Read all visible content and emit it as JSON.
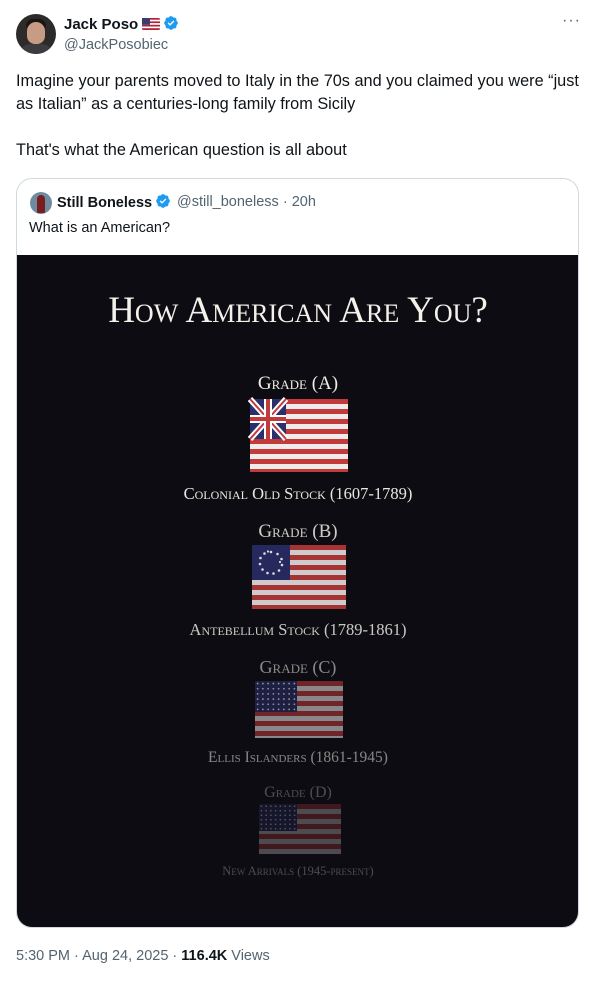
{
  "author": {
    "display_name": "Jack Poso",
    "handle": "@JackPosobiec"
  },
  "more_label": "···",
  "tweet": {
    "line1": "Imagine your parents moved to Italy in the 70s and you claimed you were “just as Italian” as a centuries-long family from Sicily",
    "line2": "That's what the American question is all about"
  },
  "quoted": {
    "display_name": "Still Boneless",
    "handle": "@still_boneless",
    "separator": "·",
    "time": "20h",
    "text": "What is an American?",
    "media": {
      "title": "How American Are You?",
      "grades": [
        {
          "label": "Grade (A)",
          "caption": "Colonial Old Stock (1607-1789)",
          "flag": "grand-union-flag",
          "opacity": 1.0
        },
        {
          "label": "Grade (B)",
          "caption": "Antebellum Stock (1789-1861)",
          "flag": "betsy-ross-flag",
          "opacity": 0.85
        },
        {
          "label": "Grade (C)",
          "caption": "Ellis Islanders (1861-1945)",
          "flag": "stars-and-stripes-flag",
          "opacity": 0.55
        },
        {
          "label": "Grade (D)",
          "caption": "New Arrivals (1945-present)",
          "flag": "modern-us-flag",
          "opacity": 0.28
        }
      ]
    }
  },
  "footer": {
    "time": "5:30 PM",
    "sep1": "·",
    "date": "Aug 24, 2025",
    "sep2": "·",
    "views_count": "116.4K",
    "views_label": "Views"
  },
  "colors": {
    "verified_blue": "#1d9bf0",
    "media_bg": "#0d0c12",
    "secondary_text": "#536471",
    "flag_red": "#b22234",
    "flag_blue": "#3c3b6e"
  }
}
